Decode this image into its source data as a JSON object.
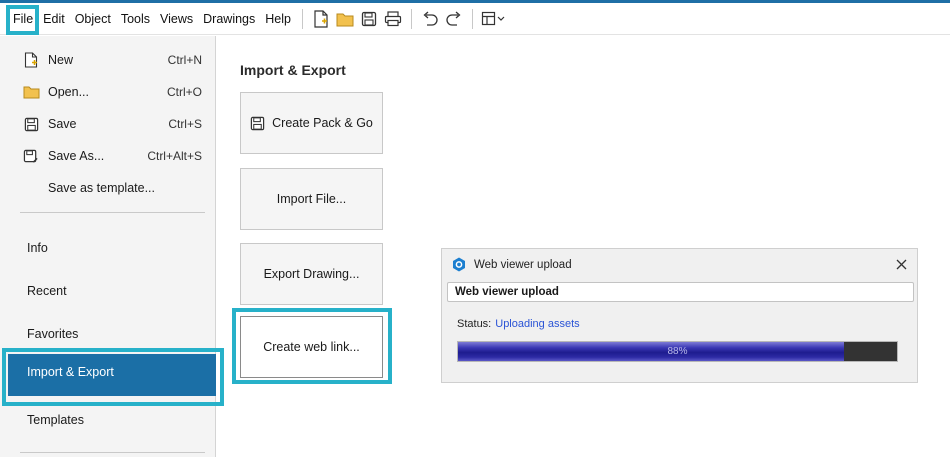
{
  "menubar": {
    "items": [
      "File",
      "Edit",
      "Object",
      "Tools",
      "Views",
      "Drawings",
      "Help"
    ],
    "toolbar_icons": [
      "new-file-icon",
      "open-folder-icon",
      "save-icon",
      "print-icon",
      "undo-icon",
      "redo-icon",
      "layout-dropdown-icon"
    ]
  },
  "file_menu": {
    "commands": [
      {
        "label": "New",
        "shortcut": "Ctrl+N",
        "icon": "new-file-icon"
      },
      {
        "label": "Open...",
        "shortcut": "Ctrl+O",
        "icon": "folder-icon"
      },
      {
        "label": "Save",
        "shortcut": "Ctrl+S",
        "icon": "save-icon"
      },
      {
        "label": "Save As...",
        "shortcut": "Ctrl+Alt+S",
        "icon": "save-as-icon"
      },
      {
        "label": "Save as template...",
        "shortcut": "",
        "icon": ""
      }
    ],
    "nav": [
      "Info",
      "Recent",
      "Favorites",
      "Import & Export",
      "Templates"
    ],
    "active_nav": "Import & Export"
  },
  "content": {
    "title": "Import & Export",
    "cards": [
      {
        "label": "Create Pack & Go",
        "icon": "save-icon"
      },
      {
        "label": "Import File...",
        "icon": ""
      },
      {
        "label": "Export Drawing...",
        "icon": ""
      },
      {
        "label": "Create web link...",
        "icon": ""
      }
    ]
  },
  "dialog": {
    "title": "Web viewer upload",
    "field_text": "Web viewer upload",
    "status_label": "Status:",
    "status_value": "Uploading assets",
    "progress_percent": 88,
    "progress_text": "88%"
  },
  "colors": {
    "accent": "#1b6fa6",
    "highlight": "#27b1c9",
    "status_link": "#2b54d6"
  }
}
